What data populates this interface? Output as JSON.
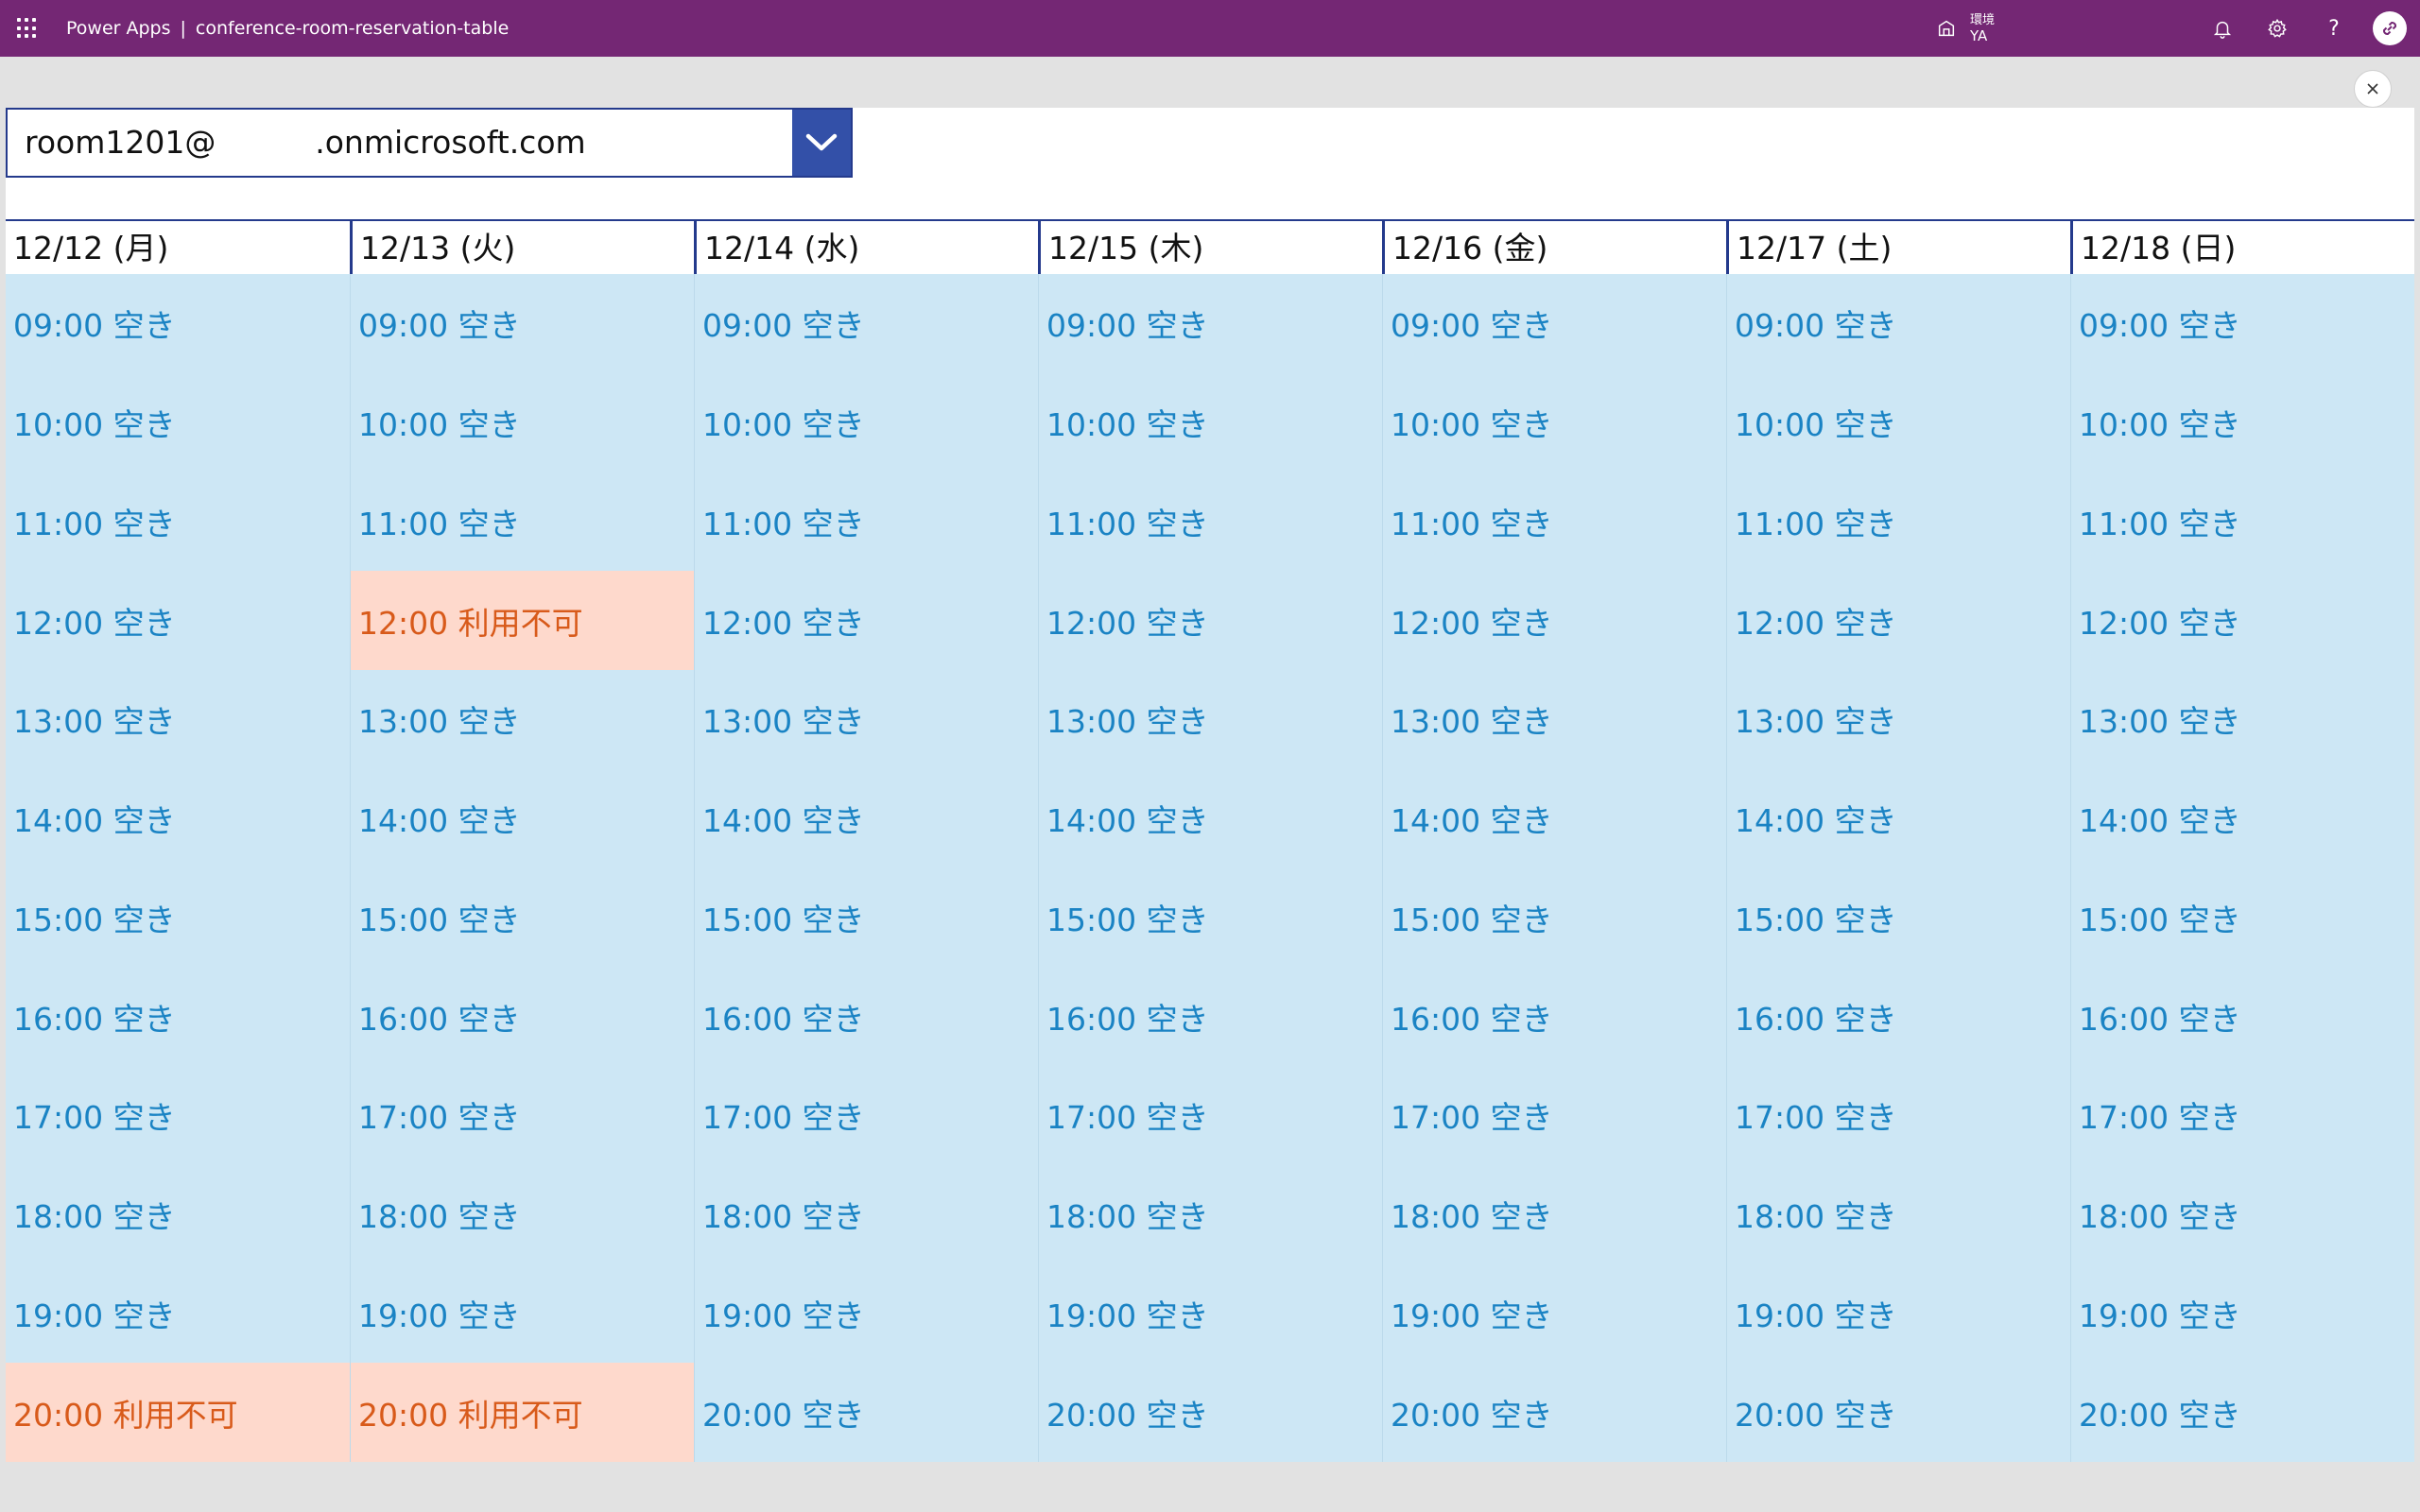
{
  "topbar": {
    "app_name": "Power Apps",
    "separator": "|",
    "app_title": "conference-room-reservation-table",
    "environment_label": "環境",
    "environment_name": "YA",
    "help_glyph": "?"
  },
  "room_dropdown": {
    "selected_value": "room1201@          .onmicrosoft.com"
  },
  "days": [
    {
      "label": "12/12 (月)",
      "slots": [
        {
          "text": "09:00 空き",
          "status": "free"
        },
        {
          "text": "10:00 空き",
          "status": "free"
        },
        {
          "text": "11:00 空き",
          "status": "free"
        },
        {
          "text": "12:00 空き",
          "status": "free"
        },
        {
          "text": "13:00 空き",
          "status": "free"
        },
        {
          "text": "14:00 空き",
          "status": "free"
        },
        {
          "text": "15:00 空き",
          "status": "free"
        },
        {
          "text": "16:00 空き",
          "status": "free"
        },
        {
          "text": "17:00 空き",
          "status": "free"
        },
        {
          "text": "18:00 空き",
          "status": "free"
        },
        {
          "text": "19:00 空き",
          "status": "free"
        },
        {
          "text": "20:00 利用不可",
          "status": "busy"
        }
      ]
    },
    {
      "label": "12/13 (火)",
      "slots": [
        {
          "text": "09:00 空き",
          "status": "free"
        },
        {
          "text": "10:00 空き",
          "status": "free"
        },
        {
          "text": "11:00 空き",
          "status": "free"
        },
        {
          "text": "12:00 利用不可",
          "status": "busy"
        },
        {
          "text": "13:00 空き",
          "status": "free"
        },
        {
          "text": "14:00 空き",
          "status": "free"
        },
        {
          "text": "15:00 空き",
          "status": "free"
        },
        {
          "text": "16:00 空き",
          "status": "free"
        },
        {
          "text": "17:00 空き",
          "status": "free"
        },
        {
          "text": "18:00 空き",
          "status": "free"
        },
        {
          "text": "19:00 空き",
          "status": "free"
        },
        {
          "text": "20:00 利用不可",
          "status": "busy"
        }
      ]
    },
    {
      "label": "12/14 (水)",
      "slots": [
        {
          "text": "09:00 空き",
          "status": "free"
        },
        {
          "text": "10:00 空き",
          "status": "free"
        },
        {
          "text": "11:00 空き",
          "status": "free"
        },
        {
          "text": "12:00 空き",
          "status": "free"
        },
        {
          "text": "13:00 空き",
          "status": "free"
        },
        {
          "text": "14:00 空き",
          "status": "free"
        },
        {
          "text": "15:00 空き",
          "status": "free"
        },
        {
          "text": "16:00 空き",
          "status": "free"
        },
        {
          "text": "17:00 空き",
          "status": "free"
        },
        {
          "text": "18:00 空き",
          "status": "free"
        },
        {
          "text": "19:00 空き",
          "status": "free"
        },
        {
          "text": "20:00 空き",
          "status": "free"
        }
      ]
    },
    {
      "label": "12/15 (木)",
      "slots": [
        {
          "text": "09:00 空き",
          "status": "free"
        },
        {
          "text": "10:00 空き",
          "status": "free"
        },
        {
          "text": "11:00 空き",
          "status": "free"
        },
        {
          "text": "12:00 空き",
          "status": "free"
        },
        {
          "text": "13:00 空き",
          "status": "free"
        },
        {
          "text": "14:00 空き",
          "status": "free"
        },
        {
          "text": "15:00 空き",
          "status": "free"
        },
        {
          "text": "16:00 空き",
          "status": "free"
        },
        {
          "text": "17:00 空き",
          "status": "free"
        },
        {
          "text": "18:00 空き",
          "status": "free"
        },
        {
          "text": "19:00 空き",
          "status": "free"
        },
        {
          "text": "20:00 空き",
          "status": "free"
        }
      ]
    },
    {
      "label": "12/16 (金)",
      "slots": [
        {
          "text": "09:00 空き",
          "status": "free"
        },
        {
          "text": "10:00 空き",
          "status": "free"
        },
        {
          "text": "11:00 空き",
          "status": "free"
        },
        {
          "text": "12:00 空き",
          "status": "free"
        },
        {
          "text": "13:00 空き",
          "status": "free"
        },
        {
          "text": "14:00 空き",
          "status": "free"
        },
        {
          "text": "15:00 空き",
          "status": "free"
        },
        {
          "text": "16:00 空き",
          "status": "free"
        },
        {
          "text": "17:00 空き",
          "status": "free"
        },
        {
          "text": "18:00 空き",
          "status": "free"
        },
        {
          "text": "19:00 空き",
          "status": "free"
        },
        {
          "text": "20:00 空き",
          "status": "free"
        }
      ]
    },
    {
      "label": "12/17 (土)",
      "slots": [
        {
          "text": "09:00 空き",
          "status": "free"
        },
        {
          "text": "10:00 空き",
          "status": "free"
        },
        {
          "text": "11:00 空き",
          "status": "free"
        },
        {
          "text": "12:00 空き",
          "status": "free"
        },
        {
          "text": "13:00 空き",
          "status": "free"
        },
        {
          "text": "14:00 空き",
          "status": "free"
        },
        {
          "text": "15:00 空き",
          "status": "free"
        },
        {
          "text": "16:00 空き",
          "status": "free"
        },
        {
          "text": "17:00 空き",
          "status": "free"
        },
        {
          "text": "18:00 空き",
          "status": "free"
        },
        {
          "text": "19:00 空き",
          "status": "free"
        },
        {
          "text": "20:00 空き",
          "status": "free"
        }
      ]
    },
    {
      "label": "12/18 (日)",
      "slots": [
        {
          "text": "09:00 空き",
          "status": "free"
        },
        {
          "text": "10:00 空き",
          "status": "free"
        },
        {
          "text": "11:00 空き",
          "status": "free"
        },
        {
          "text": "12:00 空き",
          "status": "free"
        },
        {
          "text": "13:00 空き",
          "status": "free"
        },
        {
          "text": "14:00 空き",
          "status": "free"
        },
        {
          "text": "15:00 空き",
          "status": "free"
        },
        {
          "text": "16:00 空き",
          "status": "free"
        },
        {
          "text": "17:00 空き",
          "status": "free"
        },
        {
          "text": "18:00 空き",
          "status": "free"
        },
        {
          "text": "19:00 空き",
          "status": "free"
        },
        {
          "text": "20:00 空き",
          "status": "free"
        }
      ]
    }
  ],
  "colors": {
    "topbar": "#742774",
    "free_bg": "#cde7f5",
    "free_text": "#1a83c4",
    "busy_bg": "#fed9cc",
    "busy_text": "#d85a1a",
    "accent": "#243a8c"
  },
  "icons": {
    "app_launcher": "waffle-icon",
    "environment": "environment-icon",
    "notifications": "bell-icon",
    "settings": "gear-icon",
    "help": "help-icon",
    "account": "avatar-icon",
    "close": "close-icon",
    "dropdown": "chevron-down-icon"
  }
}
